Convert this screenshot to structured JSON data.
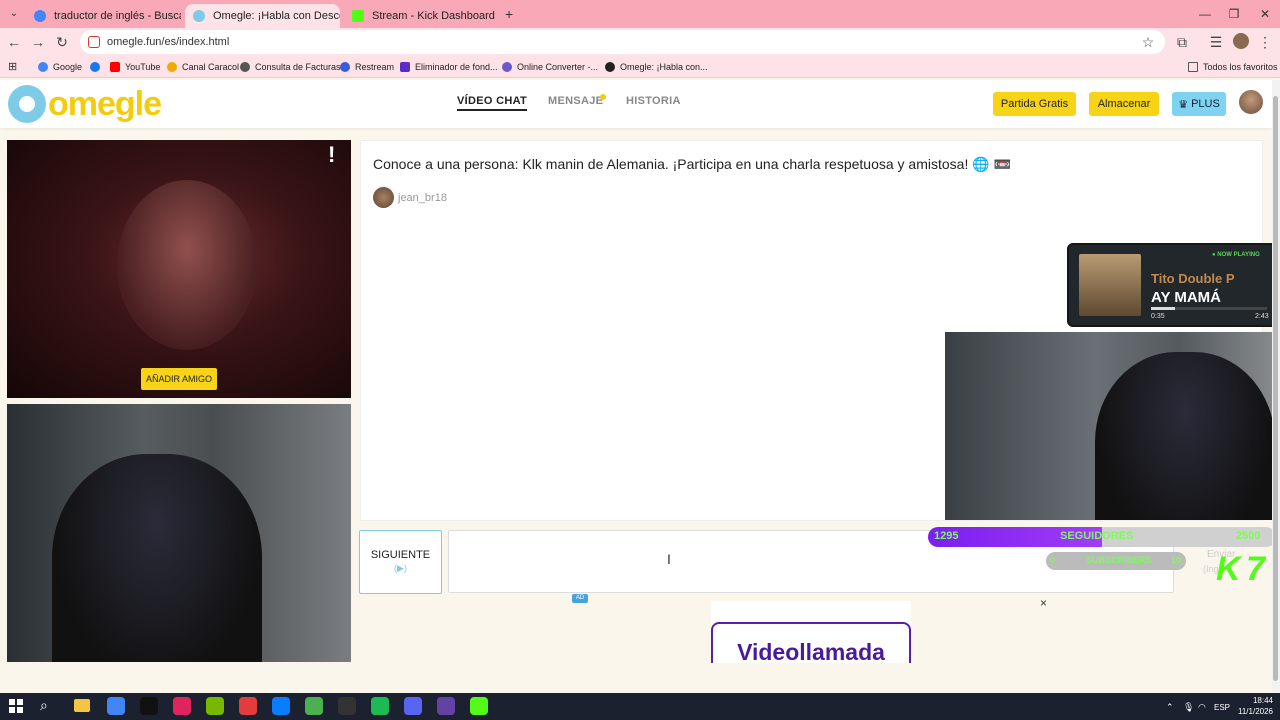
{
  "browser": {
    "tabs": [
      {
        "label": "traductor de inglés - Buscar con",
        "color": "#4285f4"
      },
      {
        "label": "Omegle: ¡Habla con Descon",
        "color": "#7ecbe8"
      },
      {
        "label": "Stream - Kick Dashboard",
        "color": "#53fc18"
      }
    ],
    "url": "omegle.fun/es/index.html",
    "bookmarks": [
      {
        "label": "Google",
        "color": "#4285f4"
      },
      {
        "label": "YouTube",
        "color": "#ff0000"
      },
      {
        "label": "Canal Caracol",
        "color": "#f2a900"
      },
      {
        "label": "Consulta de Facturas",
        "color": "#555555"
      },
      {
        "label": "Restream",
        "color": "#3b5bdb"
      },
      {
        "label": "Eliminador de fond...",
        "color": "#5b2cc4"
      },
      {
        "label": "Online Converter -...",
        "color": "#6a5acd"
      },
      {
        "label": "Omegle: ¡Habla con...",
        "color": "#222222"
      }
    ],
    "all_bookmarks": "Todos los favoritos"
  },
  "site": {
    "logo": "omegle",
    "nav": {
      "video_chat": "VÍDEO CHAT",
      "message": "MENSAJE",
      "history": "HISTORIA"
    },
    "buttons": {
      "free_match": "Partida Gratis",
      "store": "Almacenar",
      "plus": "PLUS"
    },
    "add_friend": "AÑADIR AMIGO",
    "intro": "Conoce a una persona: Klk manin de Alemania. ¡Participa en una charla respetuosa y amistosa! 🌐 📼",
    "username": "jean_br18",
    "next": "SIGUIENTE",
    "next_sub": "(▶)",
    "ad_badge": "AD",
    "ad_text": "Videollamada",
    "ad_close": "×"
  },
  "overlay": {
    "now_playing_tag": "● NOW PLAYING",
    "artist": "Tito Double P",
    "song": "AY MAMÁ",
    "time_current": "0:35",
    "time_total": "2:43",
    "progress": 0.21,
    "subs_current": "1295",
    "subs_label": "SEGUIDORES",
    "subs_goal": "2500",
    "subs2_current": "0",
    "subs2_label": "SUBSCRIBERS",
    "subs2_goal": "10",
    "kick": "K 7",
    "send_ghost": "Enviar",
    "send_ghost_sub": "(Ing"
  },
  "taskbar": {
    "lang": "ESP",
    "time": "18:44",
    "date": "11/1/2026",
    "apps": [
      "#4285f4",
      "#111111",
      "#e0245e",
      "#76b900",
      "#e43c3c",
      "#0a7cff",
      "#4caf50",
      "#333333",
      "#1db954",
      "#5865f2",
      "#6441a5",
      "#53fc18"
    ]
  }
}
